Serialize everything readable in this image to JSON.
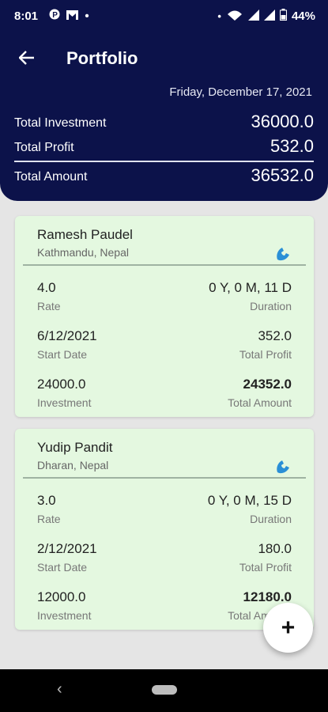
{
  "status_bar": {
    "time": "8:01",
    "left_icons": [
      "pinterest-icon",
      "gmail-icon",
      "dot-icon"
    ],
    "right_icons": [
      "dot-icon",
      "wifi-calling-icon",
      "wifi-icon",
      "signal-icon",
      "signal-icon",
      "battery-icon"
    ],
    "battery": "44%"
  },
  "header": {
    "title": "Portfolio",
    "date": "Friday, December 17, 2021",
    "total_investment_label": "Total Investment",
    "total_investment_value": "36000.0",
    "total_profit_label": "Total Profit",
    "total_profit_value": "532.0",
    "total_amount_label": "Total Amount",
    "total_amount_value": "36532.0"
  },
  "cards": [
    {
      "name": "Ramesh Paudel",
      "place": "Kathmandu, Nepal",
      "rate": "4.0",
      "rate_label": "Rate",
      "duration": "0 Y, 0 M, 11 D",
      "duration_label": "Duration",
      "start_date": "6/12/2021",
      "start_date_label": "Start Date",
      "total_profit": "352.0",
      "total_profit_label": "Total Profit",
      "investment": "24000.0",
      "investment_label": "Investment",
      "total_amount": "24352.0",
      "total_amount_label": "Total Amount"
    },
    {
      "name": "Yudip Pandit",
      "place": "Dharan, Nepal",
      "rate": "3.0",
      "rate_label": "Rate",
      "duration": "0 Y, 0 M, 15 D",
      "duration_label": "Duration",
      "start_date": "2/12/2021",
      "start_date_label": "Start Date",
      "total_profit": "180.0",
      "total_profit_label": "Total Profit",
      "investment": "12000.0",
      "investment_label": "Investment",
      "total_amount": "12180.0",
      "total_amount_label": "Total Amount"
    }
  ],
  "fab": {
    "label": "+"
  },
  "colors": {
    "header": "#0c124a",
    "card": "#e4f8e0",
    "call_icon": "#2a8fd6"
  }
}
